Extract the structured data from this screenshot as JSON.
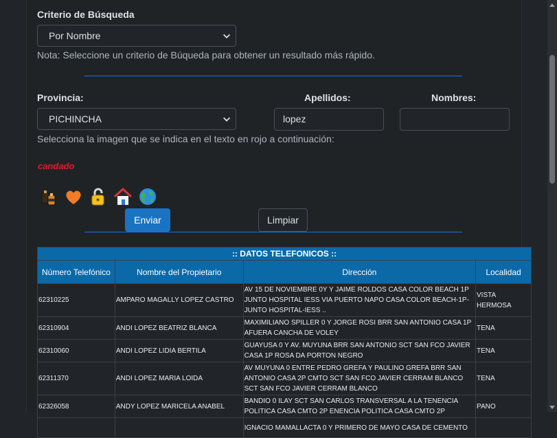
{
  "criterio": {
    "label": "Criterio de Búsqueda",
    "selected": "Por Nombre",
    "note": "Nota: Seleccione un criterio de Búqueda para obtener un resultado más rápido."
  },
  "form": {
    "provincia_label": "Provincia:",
    "provincia_value": "PICHINCHA",
    "apellidos_label": "Apellidos:",
    "apellidos_value": "lopez",
    "nombres_label": "Nombres:",
    "nombres_value": ""
  },
  "captcha": {
    "instruction": "Selecciona la imagen que se indica en el texto en rojo a continuación:",
    "word": "candado",
    "icons": [
      "battery-icon",
      "heart-icon",
      "padlock-icon",
      "house-icon",
      "globe-icon"
    ]
  },
  "buttons": {
    "enviar": "Enviar",
    "limpiar": "Limpiar"
  },
  "table": {
    "caption": ":: DATOS TELEFONICOS ::",
    "headers": [
      "Número Telefónico",
      "Nombre del Propietario",
      "Dirección",
      "Localidad"
    ],
    "rows": [
      [
        "62310225",
        "AMPARO MAGALLY LOPEZ CASTRO",
        "AV 15 DE NOVIEMBRE 0Y Y JAIME ROLDOS CASA COLOR BEACH 1P JUNTO HOSPITAL IESS VIA PUERTO NAPO CASA COLOR BEACH-1P-JUNTO HOSPITAL-IESS ..",
        "VISTA HERMOSA"
      ],
      [
        "62310904",
        "ANDI LOPEZ BEATRIZ BLANCA",
        "MAXIMILIANO SPILLER 0 Y JORGE ROSI BRR SAN ANTONIO CASA 1P AFUERA CANCHA DE VOLEY",
        "TENA"
      ],
      [
        "62310060",
        "ANDI LOPEZ LIDIA BERTILA",
        "GUAYUSA 0 Y AV. MUYUNA BRR SAN ANTONIO SCT SAN FCO JAVIER CASA 1P ROSA DA PORTON NEGRO",
        "TENA"
      ],
      [
        "62311370",
        "ANDI LOPEZ MARIA LOIDA",
        "AV MUYUNA 0 ENTRE PEDRO GREFA Y PAULINO GREFA BRR SAN ANTONIO CASA 2P CMTO SCT SAN FCO JAVIER CERRAM BLANCO SCT SAN FCO JAVIER CERRAM BLANCO",
        "TENA"
      ],
      [
        "62326058",
        "ANDY LOPEZ MARICELA ANABEL",
        "BANDIO 0 ILAY SCT SAN CARLOS TRANSVERSAL A LA TENENCIA POLITICA CASA CMTO 2P ENENCIA POLITICA CASA CMTO 2P",
        "PANO"
      ],
      [
        "",
        "",
        "IGNACIO MAMALLACTA 0 Y PRIMERO DE MAYO CASA DE CEMENTO",
        ""
      ]
    ]
  },
  "colors": {
    "background": "#212529",
    "accent": "#0b69a8",
    "captcha_word": "#e8162d"
  }
}
